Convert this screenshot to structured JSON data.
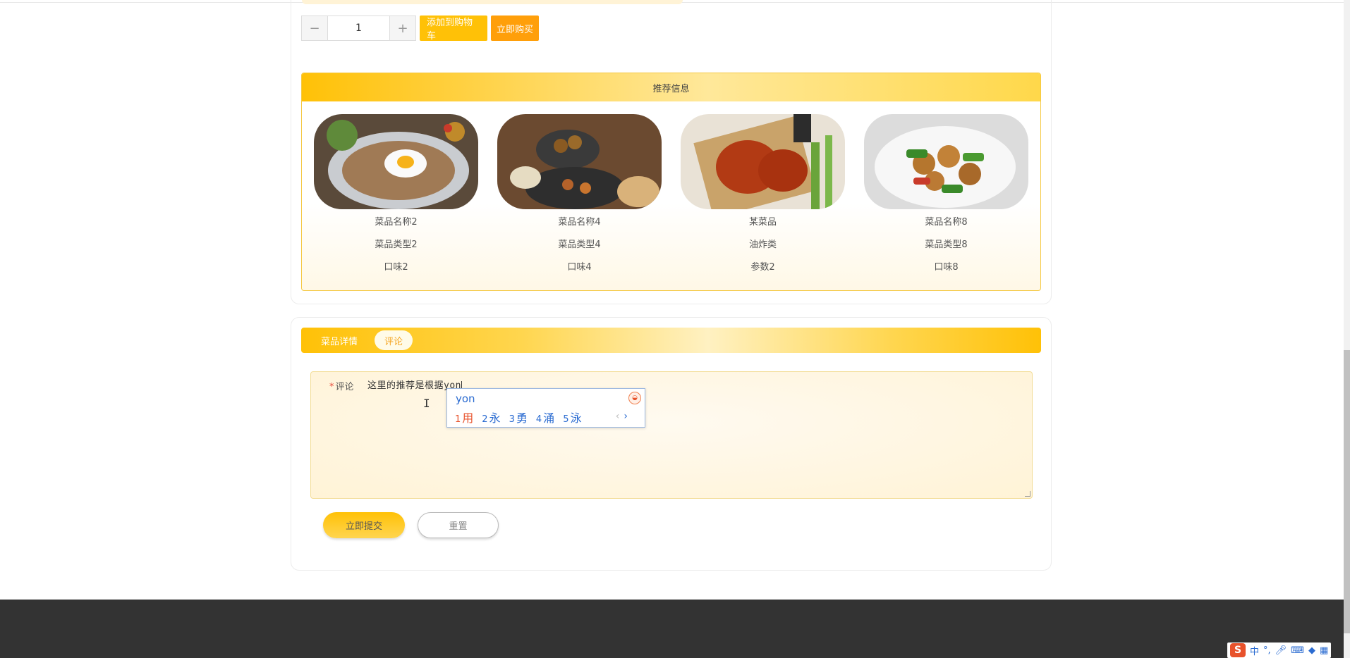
{
  "purchase": {
    "minus_label": "−",
    "plus_label": "+",
    "quantity": "1",
    "add_to_cart_label": "添加到购物车",
    "buy_now_label": "立即购买"
  },
  "recommend": {
    "title": "推荐信息",
    "items": [
      {
        "name": "菜品名称2",
        "type": "菜品类型2",
        "taste": "口味2"
      },
      {
        "name": "菜品名称4",
        "type": "菜品类型4",
        "taste": "口味4"
      },
      {
        "name": "某菜品",
        "type": "油炸类",
        "taste": "参数2"
      },
      {
        "name": "菜品名称8",
        "type": "菜品类型8",
        "taste": "口味8"
      }
    ]
  },
  "tabs": {
    "details_label": "菜品详情",
    "comments_label": "评论"
  },
  "comment_form": {
    "required_mark": "*",
    "label": "评论",
    "value": "这里的推荐是根据yon",
    "submit_label": "立即提交",
    "reset_label": "重置"
  },
  "ime": {
    "composition": "yon",
    "candidates": [
      {
        "num": "1",
        "text": "用"
      },
      {
        "num": "2",
        "text": "永"
      },
      {
        "num": "3",
        "text": "勇"
      },
      {
        "num": "4",
        "text": "涌"
      },
      {
        "num": "5",
        "text": "泳"
      }
    ],
    "prev": "‹",
    "next": "›"
  },
  "tray": {
    "logo": "S",
    "lang": "中",
    "punct": "°,"
  },
  "colors": {
    "accent": "#ffc107",
    "buy": "#ff9f0a",
    "footer": "#333333"
  }
}
